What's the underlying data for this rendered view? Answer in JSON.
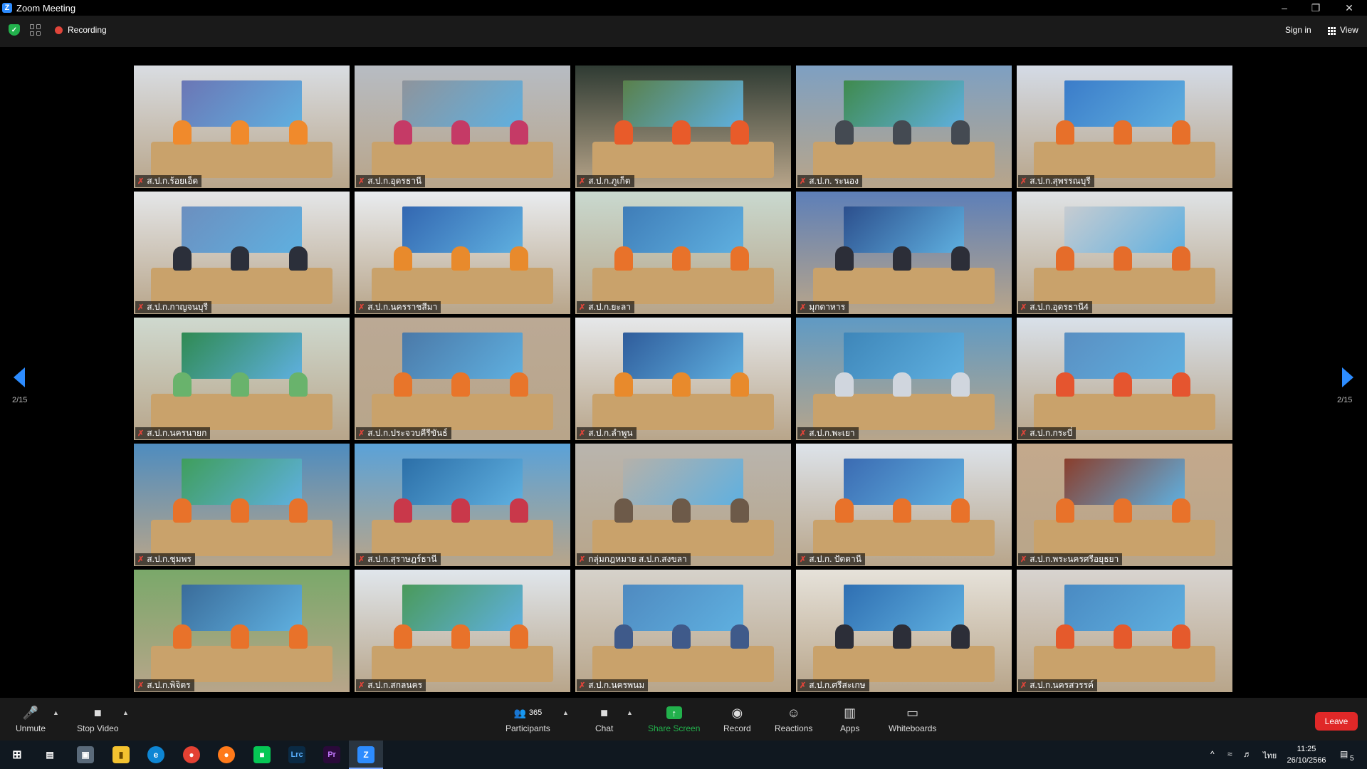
{
  "window": {
    "title": "Zoom Meeting"
  },
  "top_bar": {
    "recording_label": "Recording",
    "sign_in_label": "Sign in",
    "view_label": "View"
  },
  "pagination": {
    "left": "2/15",
    "right": "2/15"
  },
  "participant_tiles": [
    {
      "name": "ส.ป.ก.ร้อยเอ็ด",
      "wall": "#d9dde2",
      "banner": "#6b76b5",
      "shirt": "#f08a2c"
    },
    {
      "name": "ส.ป.ก.อุดรธานี",
      "wall": "#b7bcc3",
      "banner": "#8e949c",
      "shirt": "#c53a66"
    },
    {
      "name": "ส.ป.ก.ภูเก็ต",
      "wall": "#2f3b33",
      "banner": "#59804b",
      "shirt": "#e85b2a"
    },
    {
      "name": "ส.ป.ก. ระนอง",
      "wall": "#7ea0c2",
      "banner": "#3f8a4d",
      "shirt": "#444a52"
    },
    {
      "name": "ส.ป.ก.สุพรรณบุรี",
      "wall": "#d4dbe6",
      "banner": "#3b7cc9",
      "shirt": "#e7702a"
    },
    {
      "name": "ส.ป.ก.กาญจนบุรี",
      "wall": "#e4e6e8",
      "banner": "#6c8fbf",
      "shirt": "#2b2f3a"
    },
    {
      "name": "ส.ป.ก.นครราชสีมา",
      "wall": "#e9ecef",
      "banner": "#3367b1",
      "shirt": "#e88a2c"
    },
    {
      "name": "ส.ป.ก.ยะลา",
      "wall": "#c9d9cf",
      "banner": "#3f7db8",
      "shirt": "#e8722a"
    },
    {
      "name": "มุกดาหาร",
      "wall": "#5d7fb8",
      "banner": "#2c4f8d",
      "shirt": "#2c2e38"
    },
    {
      "name": "ส.ป.ก.อุดรธานี4",
      "wall": "#dfe3e6",
      "banner": "#c7ccd1",
      "shirt": "#e56c2a"
    },
    {
      "name": "ส.ป.ก.นครนายก",
      "wall": "#cfd9cf",
      "banner": "#2f8a52",
      "shirt": "#69b36c"
    },
    {
      "name": "ส.ป.ก.ประจวบคีรีขันธ์",
      "wall": "#bba995",
      "banner": "#4b79a8",
      "shirt": "#e8752a"
    },
    {
      "name": "ส.ป.ก.ลำพูน",
      "wall": "#e6e8ea",
      "banner": "#2f5c9b",
      "shirt": "#e88a2c"
    },
    {
      "name": "ส.ป.ก.พะเยา",
      "wall": "#5f9ac4",
      "banner": "#3e86b9",
      "shirt": "#d0d6de"
    },
    {
      "name": "ส.ป.ก.กระบี่",
      "wall": "#d9e1ea",
      "banner": "#5a8fc2",
      "shirt": "#e5552f"
    },
    {
      "name": "ส.ป.ก.ชุมพร",
      "wall": "#4e8cbf",
      "banner": "#3f9e5c",
      "shirt": "#e8722a"
    },
    {
      "name": "ส.ป.ก.สุราษฎร์ธานี",
      "wall": "#5aa2d8",
      "banner": "#2c6fa8",
      "shirt": "#c9384a"
    },
    {
      "name": "กลุ่มกฎหมาย ส.ป.ก.สงขลา",
      "wall": "#b9b5ae",
      "banner": "#b5b1aa",
      "shirt": "#6d5a49"
    },
    {
      "name": "ส.ป.ก. ปัตตานี",
      "wall": "#dde3ea",
      "banner": "#3b6bb2",
      "shirt": "#e8722a"
    },
    {
      "name": "ส.ป.ก.พระนครศรีอยุธยา",
      "wall": "#c4a98c",
      "banner": "#8a3e2c",
      "shirt": "#e8722a"
    },
    {
      "name": "ส.ป.ก.พิจิตร",
      "wall": "#7aa86a",
      "banner": "#3a6c9a",
      "shirt": "#e8722a"
    },
    {
      "name": "ส.ป.ก.สกลนคร",
      "wall": "#e0e6ec",
      "banner": "#4a9a5a",
      "shirt": "#e8722a"
    },
    {
      "name": "ส.ป.ก.นครพนม",
      "wall": "#d6d2cb",
      "banner": "#4f8ac0",
      "shirt": "#3f5a8a"
    },
    {
      "name": "ส.ป.ก.ศรีสะเกษ",
      "wall": "#e6e2da",
      "banner": "#2f6fb2",
      "shirt": "#2c2e38"
    },
    {
      "name": "ส.ป.ก.นครสวรรค์",
      "wall": "#d8d4d0",
      "banner": "#4a8ac2",
      "shirt": "#e55a2c"
    }
  ],
  "toolbar": {
    "unmute": "Unmute",
    "stop_video": "Stop Video",
    "participants": "Participants",
    "participants_count": "365",
    "chat": "Chat",
    "share_screen": "Share Screen",
    "record": "Record",
    "reactions": "Reactions",
    "apps": "Apps",
    "whiteboards": "Whiteboards",
    "leave": "Leave"
  },
  "taskbar": {
    "time": "11:25",
    "date": "26/10/2566",
    "language": "ไทย",
    "notifications": "5",
    "lrc_label": "Lrc",
    "pr_label": "Pr"
  },
  "colors": {
    "accent": "#2d8cff",
    "share_green": "#22b14c",
    "leave_red": "#e02828"
  }
}
